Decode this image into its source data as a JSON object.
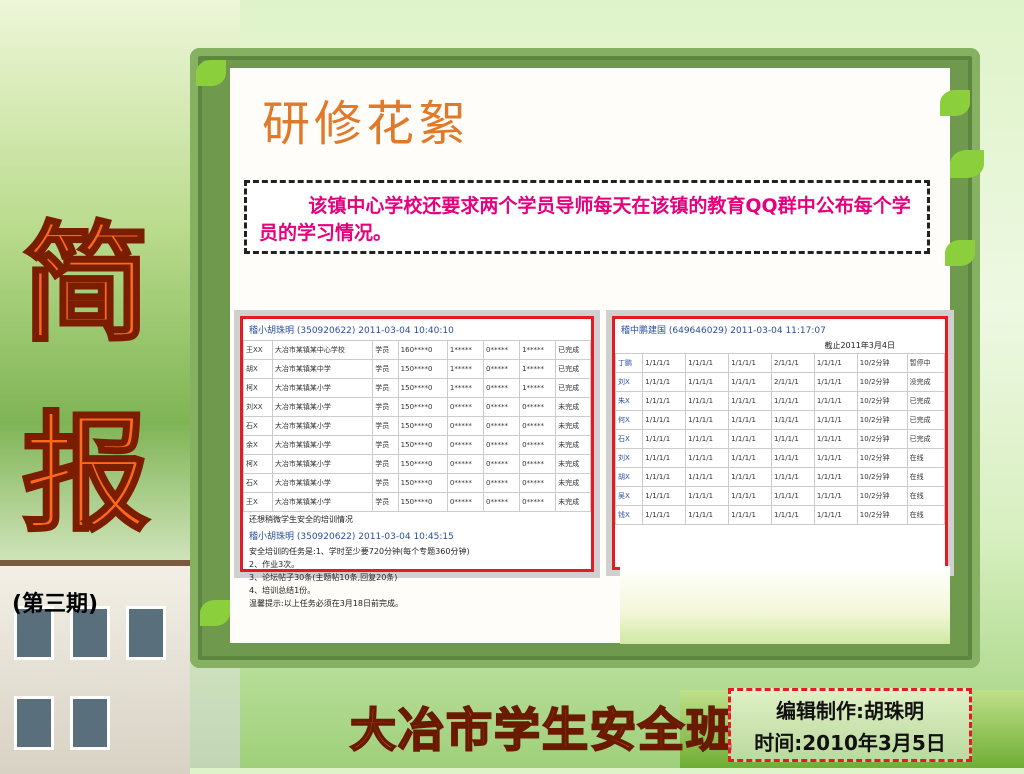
{
  "slide": {
    "section_title": "研修花絮",
    "note": "该镇中心学校还要求两个学员导师每天在该镇的教育QQ群中公布每个学员的学习情况。",
    "side_char_1": "简",
    "side_char_2": "报",
    "issue": "(第三期)",
    "footer_title": "大冶市学生安全班",
    "editor": "编辑制作:胡珠明",
    "date": "时间:2010年3月5日"
  },
  "screenshot_a": {
    "header": "稽小胡珠明 (350920622)  2011-03-04 10:40:10",
    "rows": [
      [
        "王XX",
        "大冶市某镇某中心学校",
        "学员",
        "160****0",
        "1*****",
        "0*****",
        "1*****",
        "已完成"
      ],
      [
        "胡X",
        "大冶市某镇某中学",
        "学员",
        "150****0",
        "1*****",
        "0*****",
        "1*****",
        "已完成"
      ],
      [
        "柯X",
        "大冶市某镇某小学",
        "学员",
        "150****0",
        "1*****",
        "0*****",
        "1*****",
        "已完成"
      ],
      [
        "刘XX",
        "大冶市某镇某小学",
        "学员",
        "150****0",
        "0*****",
        "0*****",
        "0*****",
        "未完成"
      ],
      [
        "石X",
        "大冶市某镇某小学",
        "学员",
        "150****0",
        "0*****",
        "0*****",
        "0*****",
        "未完成"
      ],
      [
        "余X",
        "大冶市某镇某小学",
        "学员",
        "150****0",
        "0*****",
        "0*****",
        "0*****",
        "未完成"
      ],
      [
        "柯X",
        "大冶市某镇某小学",
        "学员",
        "150****0",
        "0*****",
        "0*****",
        "0*****",
        "未完成"
      ],
      [
        "石X",
        "大冶市某镇某小学",
        "学员",
        "150****0",
        "0*****",
        "0*****",
        "0*****",
        "未完成"
      ],
      [
        "王X",
        "大冶市某镇某小学",
        "学员",
        "150****0",
        "0*****",
        "0*****",
        "0*****",
        "未完成"
      ]
    ],
    "line1": "还想稍微学生安全的培训情况",
    "header2": "稽小胡珠明 (350920622)  2011-03-04 10:45:15",
    "lines": [
      "安全培训的任务是:1、学时至少要720分钟(每个专题360分钟)",
      "2、作业3次。",
      "3、论坛帖子30条(主题帖10条,回复20条)",
      "4、培训总结1份。",
      "温馨提示:以上任务必须在3月18日前完成。"
    ]
  },
  "screenshot_b": {
    "header": "稽中鹏建国 (649646029)  2011-03-04 11:17:07",
    "subtitle": "截止2011年3月4日",
    "rows": [
      [
        "丁鹏",
        "1/1/1/1",
        "1/1/1/1",
        "1/1/1/1",
        "2/1/1/1",
        "1/1/1/1",
        "10/2分钟",
        "暂停中"
      ],
      [
        "刘X",
        "1/1/1/1",
        "1/1/1/1",
        "1/1/1/1",
        "2/1/1/1",
        "1/1/1/1",
        "10/2分钟",
        "没完成"
      ],
      [
        "朱X",
        "1/1/1/1",
        "1/1/1/1",
        "1/1/1/1",
        "1/1/1/1",
        "1/1/1/1",
        "10/2分钟",
        "已完成"
      ],
      [
        "何X",
        "1/1/1/1",
        "1/1/1/1",
        "1/1/1/1",
        "1/1/1/1",
        "1/1/1/1",
        "10/2分钟",
        "已完成"
      ],
      [
        "石X",
        "1/1/1/1",
        "1/1/1/1",
        "1/1/1/1",
        "1/1/1/1",
        "1/1/1/1",
        "10/2分钟",
        "已完成"
      ],
      [
        "刘X",
        "1/1/1/1",
        "1/1/1/1",
        "1/1/1/1",
        "1/1/1/1",
        "1/1/1/1",
        "10/2分钟",
        "在线"
      ],
      [
        "胡X",
        "1/1/1/1",
        "1/1/1/1",
        "1/1/1/1",
        "1/1/1/1",
        "1/1/1/1",
        "10/2分钟",
        "在线"
      ],
      [
        "吴X",
        "1/1/1/1",
        "1/1/1/1",
        "1/1/1/1",
        "1/1/1/1",
        "1/1/1/1",
        "10/2分钟",
        "在线"
      ],
      [
        "钱X",
        "1/1/1/1",
        "1/1/1/1",
        "1/1/1/1",
        "1/1/1/1",
        "1/1/1/1",
        "10/2分钟",
        "在线"
      ]
    ]
  }
}
